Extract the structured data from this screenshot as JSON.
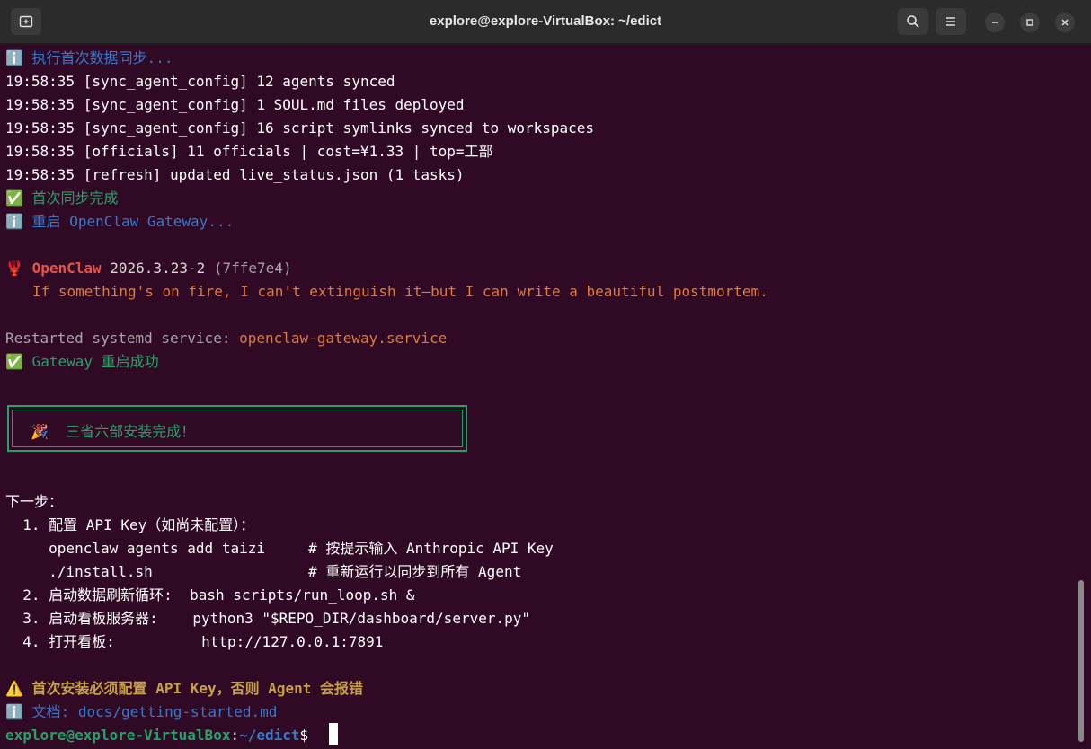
{
  "window": {
    "title": "explore@explore-VirtualBox: ~/edict"
  },
  "icons": {
    "new_tab": "new-tab-icon",
    "search": "search-icon",
    "menu": "hamburger-menu-icon",
    "minimize": "minimize-icon",
    "maximize": "maximize-icon",
    "close": "close-icon"
  },
  "terminal": {
    "sync_start": "ℹ️ 执行首次数据同步...",
    "log1": "19:58:35 [sync_agent_config] 12 agents synced",
    "log2": "19:58:35 [sync_agent_config] 1 SOUL.md files deployed",
    "log3": "19:58:35 [sync_agent_config] 16 script symlinks synced to workspaces",
    "log4": "19:58:35 [officials] 11 officials | cost=¥1.33 | top=工部",
    "log5": "19:58:35 [refresh] updated live_status.json (1 tasks)",
    "sync_done": "✅ 首次同步完成",
    "restart_gateway": "ℹ️ 重启 OpenClaw Gateway...",
    "openclaw_emoji": "🦞",
    "openclaw_name": "OpenClaw",
    "openclaw_version": "2026.3.23-2",
    "openclaw_hash": "(7ffe7e4)",
    "openclaw_tagline": "If something's on fire, I can't extinguish it—but I can write a beautiful postmortem.",
    "restarted_label": "Restarted systemd service: ",
    "restarted_service": "openclaw-gateway.service",
    "gateway_ok": "✅ Gateway 重启成功",
    "install_done": "🎉  三省六部安装完成！",
    "next_steps": "下一步：",
    "step1": "  1. 配置 API Key（如尚未配置）：",
    "step1a": "     openclaw agents add taizi     # 按提示输入 Anthropic API Key",
    "step1b": "     ./install.sh                  # 重新运行以同步到所有 Agent",
    "step2": "  2. 启动数据刷新循环:  bash scripts/run_loop.sh &",
    "step3": "  3. 启动看板服务器:    python3 \"$REPO_DIR/dashboard/server.py\"",
    "step4": "  4. 打开看板:          http://127.0.0.1:7891",
    "warning": "⚠️ 首次安装必须配置 API Key，否则 Agent 会报错",
    "docs": "ℹ️ 文档: docs/getting-started.md",
    "prompt_user": "explore@explore-VirtualBox",
    "prompt_sep": ":",
    "prompt_path": "~/edict",
    "prompt_symbol": "$"
  },
  "colors": {
    "background": "#300a24",
    "info_blue": "#3a78c9",
    "success_green": "#26a269",
    "openclaw_red": "#e5534b",
    "accent_orange": "#e0793a",
    "warning_yellow": "#c8a046"
  }
}
